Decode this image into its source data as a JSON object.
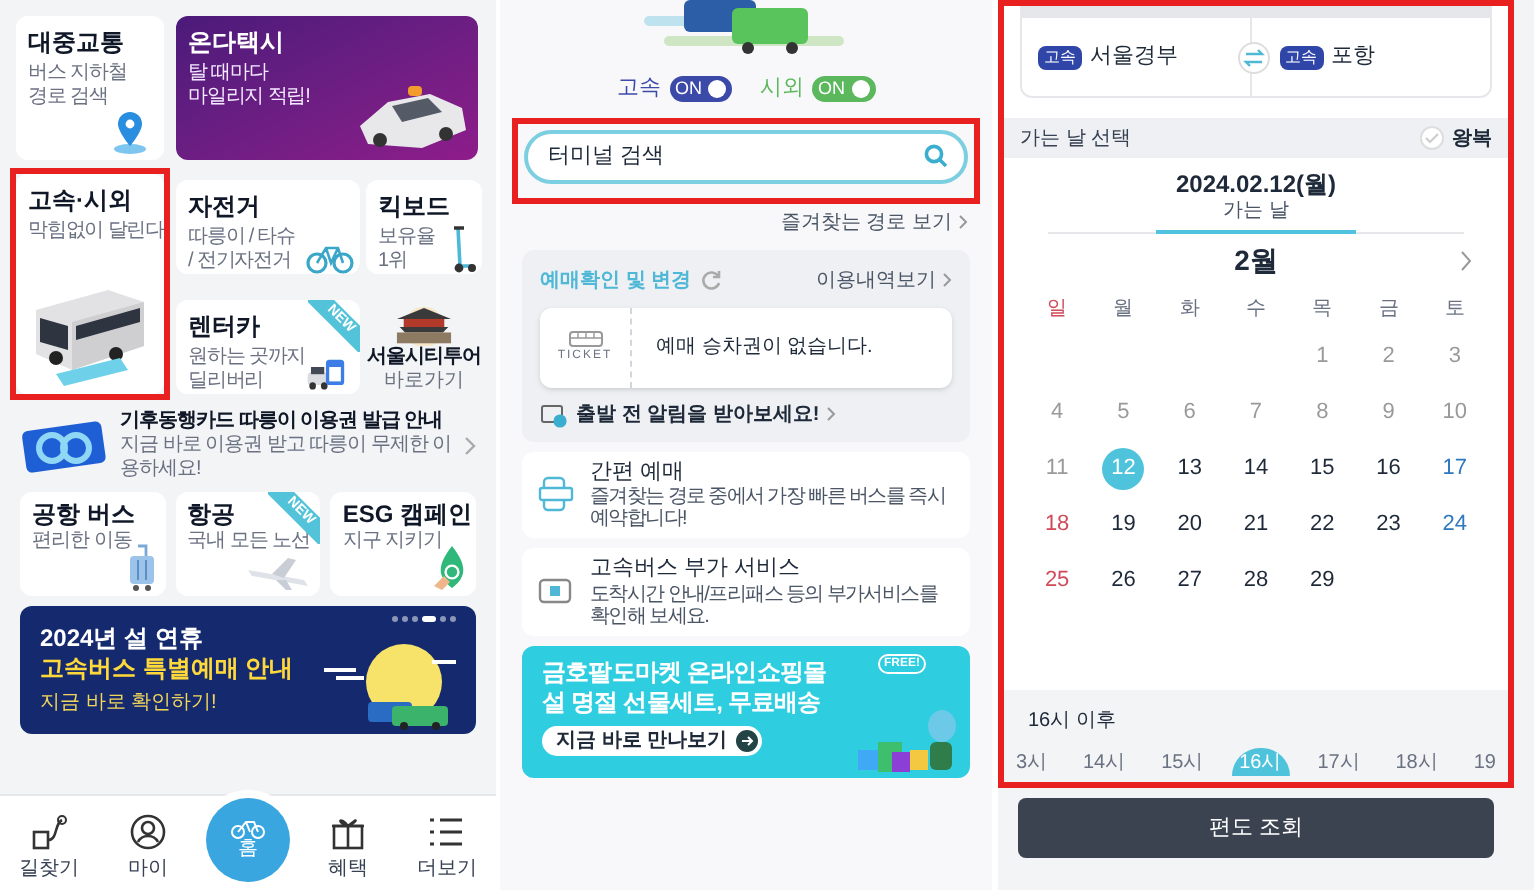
{
  "home": {
    "tiles": [
      {
        "kind": "pin",
        "title": "대중교통",
        "subtitle": "버스 지하철\n경로 검색",
        "highlighted": false
      },
      {
        "kind": "taxi",
        "title": "온다택시",
        "subtitle": "탈 때마다\n마일리지 적립!",
        "highlighted": false
      },
      {
        "kind": "bus",
        "title": "고속·시외",
        "subtitle": "막힘없이 달린다",
        "highlighted": true
      },
      {
        "kind": "bike",
        "title": "자전거",
        "subtitle": "따릉이 / 타슈\n/ 전기자전거",
        "highlighted": false
      },
      {
        "kind": "scooter",
        "title": "킥보드",
        "subtitle": "보유율\n1위",
        "highlighted": false
      },
      {
        "kind": "car",
        "title": "렌터카",
        "subtitle": "원하는 곳까지\n딜리버리",
        "badge": "NEW",
        "highlighted": false
      },
      {
        "kind": "palace",
        "title": "서울시티투어",
        "subtitle": "바로가기",
        "highlighted": false
      }
    ],
    "promo": {
      "title": "기후동행카드 따릉이 이용권 발급 안내",
      "subtitle": "지금 바로 이용권 받고 따릉이 무제한 이용하세요!"
    },
    "small_tiles": [
      {
        "kind": "luggage",
        "title": "공항 버스",
        "subtitle": "편리한 이동"
      },
      {
        "kind": "plane",
        "title": "항공",
        "subtitle": "국내 모든 노선",
        "badge": "NEW"
      },
      {
        "kind": "leaf",
        "title": "ESG 캠페인",
        "subtitle": "지구 지키기"
      }
    ],
    "banner": {
      "line_1": "2024년 설 연휴",
      "line_2": "고속버스 특별예매 안내",
      "line_3": "지금 바로 확인하기!",
      "pages": [
        {
          "selected": false
        },
        {
          "selected": false
        },
        {
          "selected": false
        },
        {
          "selected": true
        },
        {
          "selected": false
        },
        {
          "selected": false
        }
      ]
    },
    "nav": [
      {
        "kind": "route",
        "label": "길찾기"
      },
      {
        "kind": "person",
        "label": "마이"
      },
      {
        "kind": "home",
        "label": "홈"
      },
      {
        "kind": "gift",
        "label": "혜택"
      },
      {
        "kind": "list",
        "label": "더보기"
      }
    ]
  },
  "bus": {
    "toggles": [
      {
        "label": "고속",
        "state": "ON",
        "on": true,
        "color": "#3b4aa8"
      },
      {
        "label": "시외",
        "state": "ON",
        "on": true,
        "color": "#5cb85c"
      }
    ],
    "search": {
      "placeholder": "터미널 검색",
      "highlighted": true
    },
    "favorites_link": "즐겨찾는 경로 보기",
    "reservation": {
      "title": "예매확인 및 변경",
      "history_link": "이용내역보기",
      "ticket_label": "TICKET",
      "empty_text": "예매 승차권이 없습니다.",
      "alert": "출발 전 알림을 받아보세요!"
    },
    "services": [
      {
        "kind": "ticket",
        "title": "간편 예매",
        "subtitle": "즐겨찾는 경로 중에서 가장 빠른 버스를 즉시 예약합니다!"
      },
      {
        "kind": "extra",
        "title": "고속버스 부가 서비스",
        "subtitle": "도착시간 안내/프리패스 등의 부가서비스를 확인해 보세요."
      }
    ],
    "ad": {
      "line_1": "금호팔도마켓 온라인쇼핑몰",
      "line_2": "설 명절 선물세트, 무료배송",
      "sticker": "FREE!",
      "button": "지금 바로 만나보기"
    }
  },
  "booking": {
    "highlighted": true,
    "departure": {
      "badge": "고속",
      "name": "서울경부"
    },
    "arrival": {
      "badge": "고속",
      "name": "포항"
    },
    "date_bar": {
      "label": "가는 날 선택",
      "round_trip": {
        "label": "왕복",
        "checked": false
      }
    },
    "selected_date": "2024.02.12(월)",
    "date_tab": {
      "label": "가는 날",
      "selected": true
    },
    "month": "2월",
    "weekdays": [
      "일",
      "월",
      "화",
      "수",
      "목",
      "금",
      "토"
    ],
    "weeks": [
      [
        {
          "kind": "blank"
        },
        {
          "kind": "blank"
        },
        {
          "kind": "blank"
        },
        {
          "kind": "blank"
        },
        {
          "kind": "day",
          "day": "1",
          "disabled": true,
          "selected": false
        },
        {
          "kind": "day",
          "day": "2",
          "disabled": true,
          "selected": false
        },
        {
          "kind": "day",
          "day": "3",
          "disabled": true,
          "selected": false
        }
      ],
      [
        {
          "kind": "day",
          "day": "4",
          "disabled": true,
          "selected": false
        },
        {
          "kind": "day",
          "day": "5",
          "disabled": true,
          "selected": false
        },
        {
          "kind": "day",
          "day": "6",
          "disabled": true,
          "selected": false
        },
        {
          "kind": "day",
          "day": "7",
          "disabled": true,
          "selected": false
        },
        {
          "kind": "day",
          "day": "8",
          "disabled": true,
          "selected": false
        },
        {
          "kind": "day",
          "day": "9",
          "disabled": true,
          "selected": false
        },
        {
          "kind": "day",
          "day": "10",
          "disabled": true,
          "selected": false
        }
      ],
      [
        {
          "kind": "day",
          "day": "11",
          "disabled": true,
          "selected": false
        },
        {
          "kind": "day",
          "day": "12",
          "disabled": false,
          "selected": true
        },
        {
          "kind": "day",
          "day": "13",
          "disabled": false,
          "selected": false
        },
        {
          "kind": "day",
          "day": "14",
          "disabled": false,
          "selected": false
        },
        {
          "kind": "day",
          "day": "15",
          "disabled": false,
          "selected": false
        },
        {
          "kind": "day",
          "day": "16",
          "disabled": false,
          "selected": false
        },
        {
          "kind": "day",
          "day": "17",
          "disabled": false,
          "selected": false
        }
      ],
      [
        {
          "kind": "day",
          "day": "18",
          "disabled": false,
          "selected": false
        },
        {
          "kind": "day",
          "day": "19",
          "disabled": false,
          "selected": false
        },
        {
          "kind": "day",
          "day": "20",
          "disabled": false,
          "selected": false
        },
        {
          "kind": "day",
          "day": "21",
          "disabled": false,
          "selected": false
        },
        {
          "kind": "day",
          "day": "22",
          "disabled": false,
          "selected": false
        },
        {
          "kind": "day",
          "day": "23",
          "disabled": false,
          "selected": false
        },
        {
          "kind": "day",
          "day": "24",
          "disabled": false,
          "selected": false
        }
      ],
      [
        {
          "kind": "day",
          "day": "25",
          "disabled": false,
          "selected": false
        },
        {
          "kind": "day",
          "day": "26",
          "disabled": false,
          "selected": false
        },
        {
          "kind": "day",
          "day": "27",
          "disabled": false,
          "selected": false
        },
        {
          "kind": "day",
          "day": "28",
          "disabled": false,
          "selected": false
        },
        {
          "kind": "day",
          "day": "29",
          "disabled": false,
          "selected": false
        },
        {
          "kind": "blank"
        },
        {
          "kind": "blank"
        }
      ]
    ],
    "time_label": "16시 이후",
    "hours": [
      {
        "label": "3시",
        "selected": false
      },
      {
        "label": "14시",
        "selected": false
      },
      {
        "label": "15시",
        "selected": false
      },
      {
        "label": "16시",
        "selected": true
      },
      {
        "label": "17시",
        "selected": false
      },
      {
        "label": "18시",
        "selected": false
      },
      {
        "label": "19",
        "selected": false
      }
    ],
    "search_button": "편도 조회"
  }
}
